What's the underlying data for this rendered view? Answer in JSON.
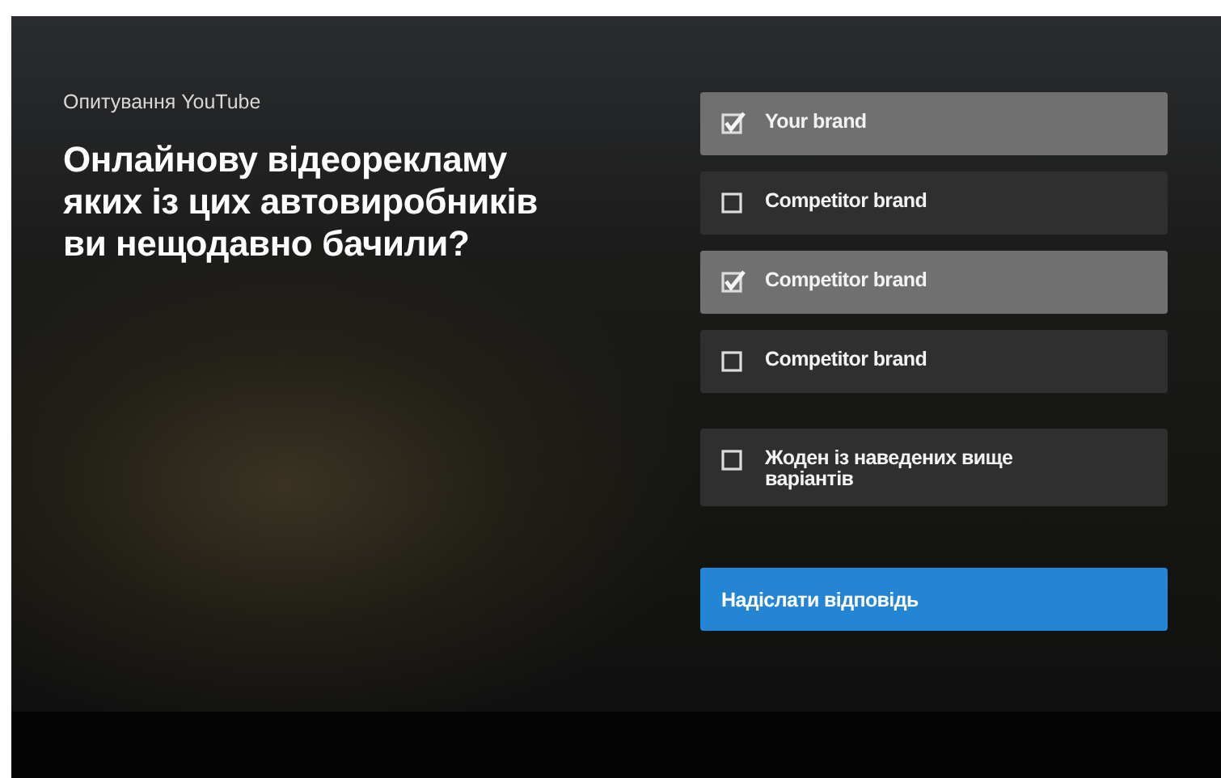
{
  "survey": {
    "label": "Опитування YouTube",
    "question": "Онлайнову відеорекламу яких із цих автовиробників ви нещодавно бачили?"
  },
  "options": [
    {
      "label": "Your brand",
      "checked": true,
      "kind": "brand"
    },
    {
      "label": "Competitor brand",
      "checked": false,
      "kind": "brand"
    },
    {
      "label": "Competitor brand",
      "checked": true,
      "kind": "brand"
    },
    {
      "label": "Competitor brand",
      "checked": false,
      "kind": "brand"
    },
    {
      "label": "Жоден із наведених вище варіантів",
      "checked": false,
      "kind": "none"
    }
  ],
  "submit_button": {
    "label": "Надіслати відповідь"
  }
}
